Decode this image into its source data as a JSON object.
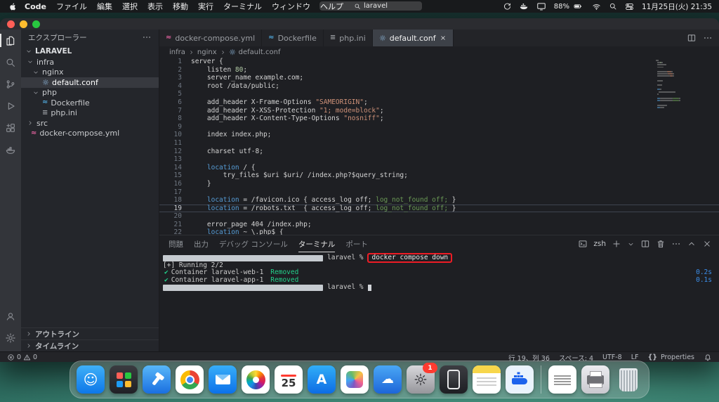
{
  "colors": {
    "highlight_red": "#ee1c25",
    "terminal_green": "#23d18b",
    "terminal_blue": "#3b8eea",
    "keyword_blue": "#569cd6",
    "string_orange": "#ce9178",
    "comment_green": "#6a9955"
  },
  "menu_bar": {
    "app_name": "Code",
    "items": [
      "ファイル",
      "編集",
      "選択",
      "表示",
      "移動",
      "実行",
      "ターミナル",
      "ウィンドウ",
      "ヘルプ"
    ],
    "search_value": "laravel",
    "battery_percent": "88%",
    "clock": "11月25日(火) 21:35"
  },
  "editor_tabs": [
    {
      "label": "docker-compose.yml",
      "icon": "compose",
      "active": false
    },
    {
      "label": "Dockerfile",
      "icon": "docker",
      "active": false
    },
    {
      "label": "php.ini",
      "icon": "ini",
      "active": false
    },
    {
      "label": "default.conf",
      "icon": "conf",
      "active": true
    }
  ],
  "file_icons": {
    "compose": {
      "glyph": "≈",
      "color": "#e0619e"
    },
    "docker": {
      "glyph": "≈",
      "color": "#4fa6d8"
    },
    "ini": {
      "glyph": "≡",
      "color": "#9da0a5"
    },
    "conf": {
      "glyph": "⚙",
      "color": "#84aacb"
    }
  },
  "breadcrumb": [
    "infra",
    "nginx",
    "default.conf"
  ],
  "activity_bar": {
    "top": [
      "explorer",
      "search",
      "source-control",
      "run-and-debug",
      "extensions",
      "docker"
    ],
    "bottom": [
      "accounts",
      "settings"
    ]
  },
  "sidebar": {
    "title": "エクスプローラー",
    "root": "LARAVEL",
    "tree": [
      {
        "label": "infra",
        "kind": "folder",
        "open": true,
        "indent": 0
      },
      {
        "label": "nginx",
        "kind": "folder",
        "open": true,
        "indent": 1
      },
      {
        "label": "default.conf",
        "kind": "file",
        "icon": "conf",
        "indent": 2,
        "selected": true
      },
      {
        "label": "php",
        "kind": "folder",
        "open": true,
        "indent": 1
      },
      {
        "label": "Dockerfile",
        "kind": "file",
        "icon": "docker",
        "indent": 2
      },
      {
        "label": "php.ini",
        "kind": "file",
        "icon": "ini",
        "indent": 2
      },
      {
        "label": "src",
        "kind": "folder",
        "open": false,
        "indent": 0
      },
      {
        "label": "docker-compose.yml",
        "kind": "file",
        "icon": "compose",
        "indent": 0
      }
    ],
    "bottom_sections": [
      "アウトライン",
      "タイムライン"
    ]
  },
  "editor": {
    "current_line": 19,
    "lines": [
      {
        "n": 1,
        "s": [
          [
            "fg",
            "server {"
          ]
        ]
      },
      {
        "n": 2,
        "s": [
          [
            "fg",
            "    listen "
          ],
          [
            "num",
            "80"
          ],
          [
            "fg",
            ";"
          ]
        ]
      },
      {
        "n": 3,
        "s": [
          [
            "fg",
            "    server_name example.com;"
          ]
        ]
      },
      {
        "n": 4,
        "s": [
          [
            "fg",
            "    root /data/public;"
          ]
        ]
      },
      {
        "n": 5,
        "s": []
      },
      {
        "n": 6,
        "s": [
          [
            "fg",
            "    add_header X-Frame-Options "
          ],
          [
            "str",
            "\"SAMEORIGIN\""
          ],
          [
            "fg",
            ";"
          ]
        ]
      },
      {
        "n": 7,
        "s": [
          [
            "fg",
            "    add_header X-XSS-Protection "
          ],
          [
            "str",
            "\"1; mode=block\""
          ],
          [
            "fg",
            ";"
          ]
        ]
      },
      {
        "n": 8,
        "s": [
          [
            "fg",
            "    add_header X-Content-Type-Options "
          ],
          [
            "str",
            "\"nosniff\""
          ],
          [
            "fg",
            ";"
          ]
        ]
      },
      {
        "n": 9,
        "s": []
      },
      {
        "n": 10,
        "s": [
          [
            "fg",
            "    index index.php;"
          ]
        ]
      },
      {
        "n": 11,
        "s": []
      },
      {
        "n": 12,
        "s": [
          [
            "fg",
            "    charset utf-8;"
          ]
        ]
      },
      {
        "n": 13,
        "s": []
      },
      {
        "n": 14,
        "s": [
          [
            "kw",
            "    location"
          ],
          [
            "fg",
            " / {"
          ]
        ]
      },
      {
        "n": 15,
        "s": [
          [
            "fg",
            "        try_files $uri $uri/ /index.php?$query_string;"
          ]
        ]
      },
      {
        "n": 16,
        "s": [
          [
            "fg",
            "    }"
          ]
        ]
      },
      {
        "n": 17,
        "s": []
      },
      {
        "n": 18,
        "s": [
          [
            "kw",
            "    location"
          ],
          [
            "fg",
            " = /favicon.ico { access_log off; "
          ],
          [
            "grn",
            "log_not_found off;"
          ],
          [
            "fg",
            " }"
          ]
        ]
      },
      {
        "n": 19,
        "s": [
          [
            "kw",
            "    location"
          ],
          [
            "fg",
            " = /robots.txt  { access_log off; "
          ],
          [
            "grn",
            "log_not_found off;"
          ],
          [
            "fg",
            " }"
          ]
        ]
      },
      {
        "n": 20,
        "s": []
      },
      {
        "n": 21,
        "s": [
          [
            "fg",
            "    error_page 404 /index.php;"
          ]
        ]
      },
      {
        "n": 22,
        "s": [
          [
            "kw",
            "    location"
          ],
          [
            "fg",
            " ~ \\.php$ {"
          ]
        ]
      }
    ]
  },
  "panel": {
    "tabs": [
      {
        "label": "問題",
        "active": false
      },
      {
        "label": "出力",
        "active": false
      },
      {
        "label": "デバッグ コンソール",
        "active": false
      },
      {
        "label": "ターミナル",
        "active": true
      },
      {
        "label": "ポート",
        "active": false
      }
    ],
    "shell_name": "zsh",
    "terminal": {
      "check_glyph": "✔",
      "lines": [
        {
          "type": "cmd",
          "redacted": true,
          "prompt": "laravel %",
          "command": "docker compose down",
          "boxed": true
        },
        {
          "type": "out",
          "text": "[+] Running 2/2"
        },
        {
          "type": "check",
          "text": "Container laravel-web-1",
          "status": "Removed",
          "time": "0.2s"
        },
        {
          "type": "check",
          "text": "Container laravel-app-1",
          "status": "Removed",
          "time": "0.1s"
        },
        {
          "type": "prompt",
          "redacted": true,
          "prompt": "laravel %",
          "cursor": true
        }
      ]
    }
  },
  "status_bar": {
    "errors": "0",
    "warnings": "0",
    "line_col": "行 19、列 36",
    "indent": "スペース: 4",
    "encoding": "UTF-8",
    "eol": "LF",
    "braces": "{}",
    "language": "Properties"
  },
  "dock": {
    "calendar_day": "25",
    "settings_badge": "1",
    "items": [
      {
        "name": "finder"
      },
      {
        "name": "launchpad"
      },
      {
        "name": "xcode"
      },
      {
        "name": "chrome"
      },
      {
        "name": "mail"
      },
      {
        "name": "photos"
      },
      {
        "name": "calendar"
      },
      {
        "name": "app-store"
      },
      {
        "name": "freeform"
      },
      {
        "name": "weather"
      },
      {
        "name": "system-settings"
      },
      {
        "name": "iphone-mirroring"
      },
      {
        "name": "notes"
      },
      {
        "name": "docker"
      },
      {
        "name": "divider"
      },
      {
        "name": "textedit"
      },
      {
        "name": "printer"
      },
      {
        "name": "trash"
      }
    ]
  }
}
